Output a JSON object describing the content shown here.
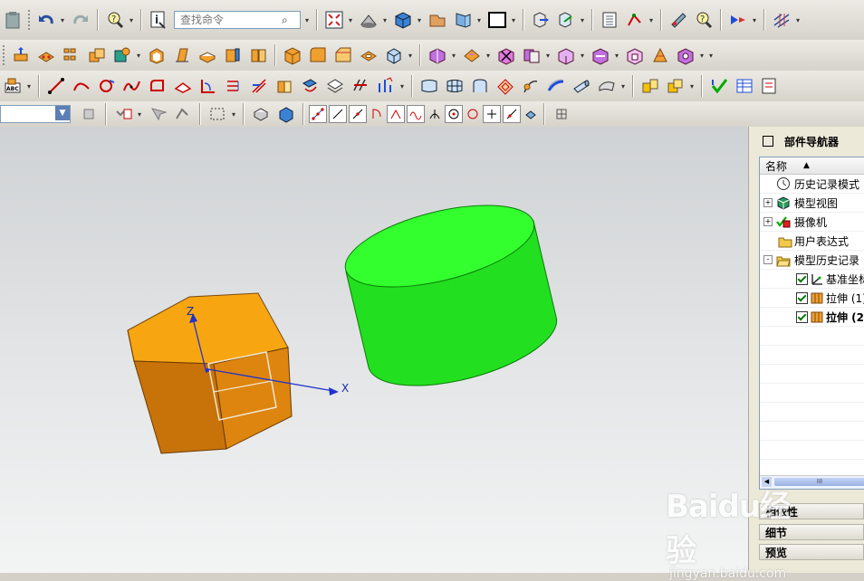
{
  "toolbar": {
    "search_placeholder": "查找命令"
  },
  "viewport": {
    "axis_z_label": "Z",
    "axis_x_label": "X",
    "colors": {
      "prism_top": "#f7a612",
      "prism_left": "#c87309",
      "prism_right": "#dd850f",
      "cylinder_side": "#22e01f",
      "cylinder_top": "#33ff2e",
      "axis": "#2233cc"
    }
  },
  "navigator": {
    "title": "部件导航器",
    "column_header": "名称",
    "items": [
      {
        "label": "历史记录模式",
        "icon": "clock-icon"
      },
      {
        "label": "模型视图",
        "icon": "model-view-icon",
        "expand": "+"
      },
      {
        "label": "摄像机",
        "icon": "camera-icon",
        "expand": "+"
      },
      {
        "label": "用户表达式",
        "icon": "folder-icon"
      },
      {
        "label": "模型历史记录",
        "icon": "folder-open-icon",
        "expand": "-"
      },
      {
        "label": "基准坐标",
        "icon": "datum-csys-icon",
        "checked": true
      },
      {
        "label": "拉伸 (1)",
        "icon": "extrude-icon",
        "checked": true
      },
      {
        "label": "拉伸 (2",
        "icon": "extrude-icon",
        "checked": true
      }
    ],
    "scroll_thumb_label": "III",
    "panels": [
      "相依性",
      "细节",
      "预览"
    ]
  },
  "watermark": {
    "logo": "Baidu经验",
    "url": "jingyan.baidu.com"
  }
}
